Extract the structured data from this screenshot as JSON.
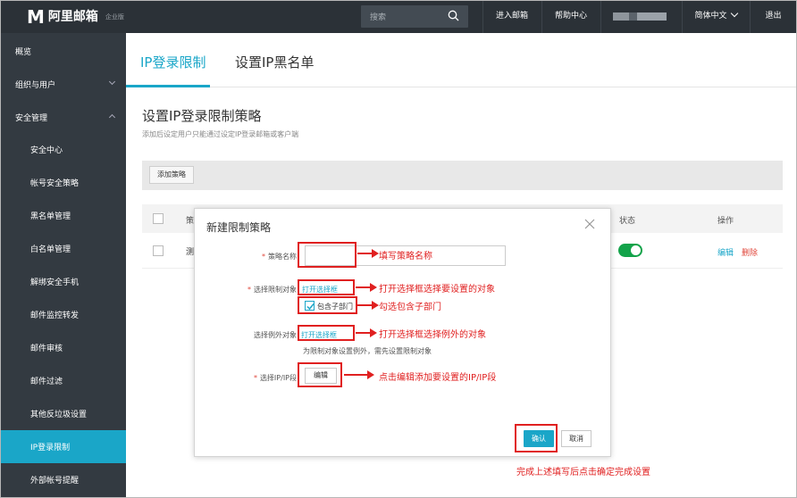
{
  "topbar": {
    "logo_mark": "M",
    "logo_text": "阿里邮箱",
    "logo_edition": "企业版",
    "search_placeholder": "搜索",
    "enter_mail": "进入邮箱",
    "help_center": "帮助中心",
    "language": "简体中文",
    "logout": "退出"
  },
  "sidebar": {
    "overview": "概览",
    "org_users": "组织与用户",
    "security": "安全管理",
    "items": [
      {
        "label": "安全中心"
      },
      {
        "label": "帐号安全策略"
      },
      {
        "label": "黑名单管理"
      },
      {
        "label": "白名单管理"
      },
      {
        "label": "解绑安全手机"
      },
      {
        "label": "邮件监控转发"
      },
      {
        "label": "邮件审核"
      },
      {
        "label": "邮件过滤"
      },
      {
        "label": "其他反垃圾设置"
      },
      {
        "label": "IP登录限制",
        "active": true
      },
      {
        "label": "外部帐号提醒"
      }
    ]
  },
  "tabs": {
    "ip_limit": "IP登录限制",
    "ip_blacklist": "设置IP黑名单"
  },
  "main": {
    "title": "设置IP登录限制策略",
    "description": "添加后设定用户只能通过设定IP登录邮箱或客户端",
    "add_policy": "添加策略",
    "table": {
      "col_name": "策",
      "col_status": "状态",
      "col_action": "操作",
      "row_name": "测",
      "row_status_on": true,
      "row_edit": "编辑",
      "row_delete": "删除"
    }
  },
  "dialog": {
    "title": "新建限制策略",
    "name_label": "策略名称",
    "target_label": "选择限制对象",
    "open_picker": "打开选择框",
    "include_sub": "包含子部门",
    "include_sub_checked": true,
    "exclude_label": "选择例外对象",
    "open_picker_exclude": "打开选择框",
    "exclude_hint": "为限制对象设置例外，需先设置限制对象",
    "ip_label": "选择IP/IP段",
    "edit": "编辑",
    "confirm": "确认",
    "cancel": "取消"
  },
  "annotations": {
    "name": "填写策略名称",
    "target": "打开选择框选择要设置的对象",
    "include": "勾选包含子部门",
    "exclude": "打开选择框选择例外的对象",
    "ip": "点击编辑添加要设置的IP/IP段",
    "confirm": "完成上述填写后点击确定完成设置"
  },
  "colors": {
    "accent": "#1aa6c8",
    "topbar": "#2b3137",
    "sidebar": "#333a41",
    "annotation": "#e02020",
    "toggle_on": "#13a34a"
  }
}
